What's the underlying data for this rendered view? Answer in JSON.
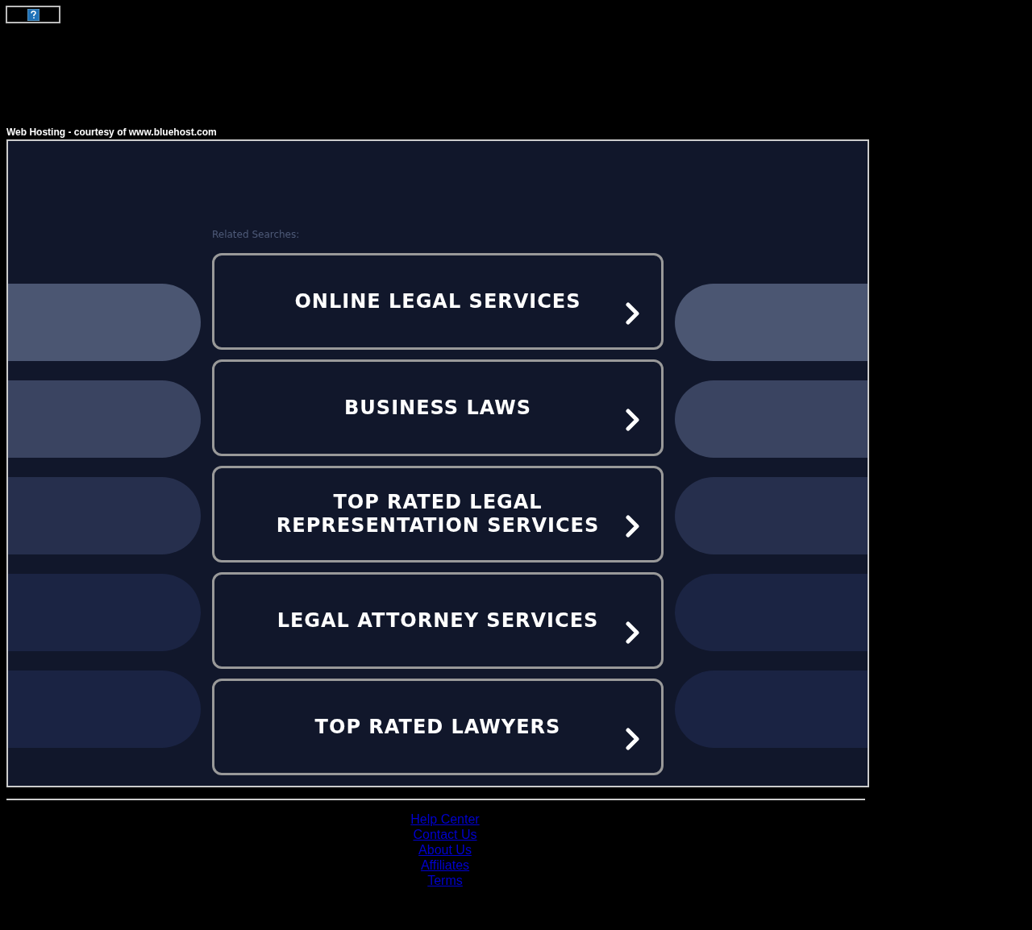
{
  "hosting_caption": "Web Hosting - courtesy of www.bluehost.com",
  "related": {
    "label": "Related Searches:",
    "items": [
      {
        "label": "ONLINE LEGAL SERVICES"
      },
      {
        "label": "BUSINESS LAWS"
      },
      {
        "label": "TOP RATED LEGAL REPRESENTATION SERVICES"
      },
      {
        "label": "LEGAL ATTORNEY SERVICES"
      },
      {
        "label": "TOP RATED LAWYERS"
      }
    ]
  },
  "footer_links": [
    "Help Center",
    "Contact Us",
    "About Us",
    "Affiliates",
    "Terms"
  ]
}
